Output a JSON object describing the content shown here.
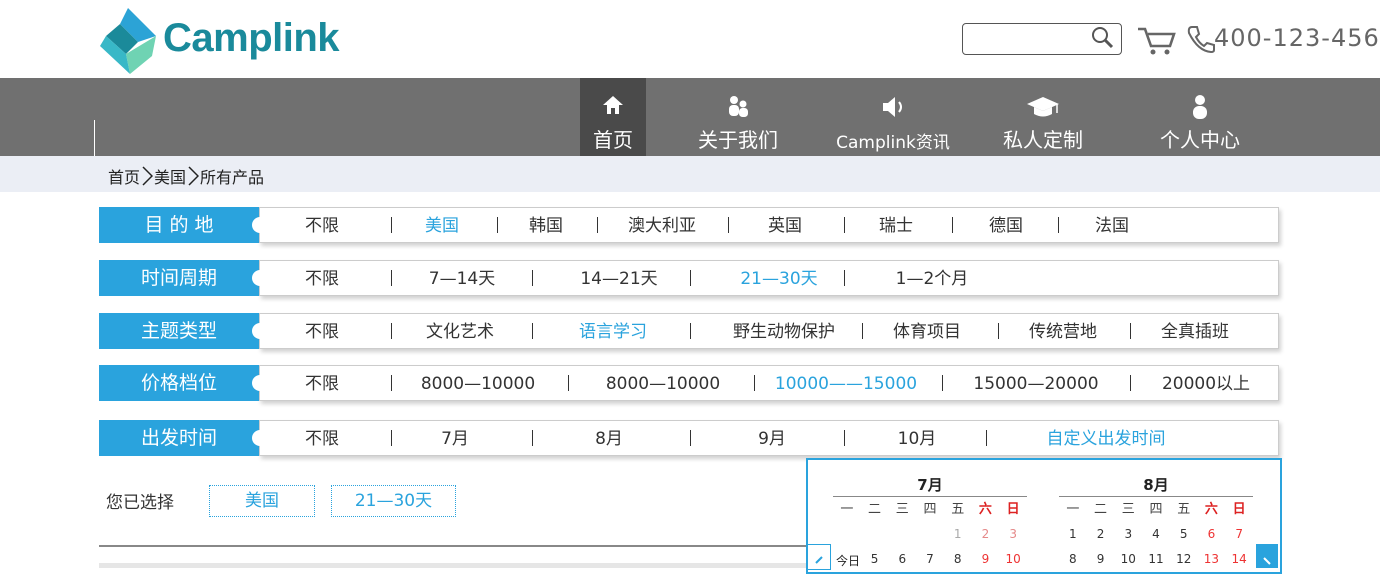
{
  "header": {
    "logo_text": "Camplink",
    "search": {
      "value": "",
      "placeholder": ""
    },
    "phone": "400-123-456"
  },
  "nav": {
    "items": [
      {
        "label": "首页",
        "icon": "home-icon",
        "active": true
      },
      {
        "label": "关于我们",
        "icon": "users-icon"
      },
      {
        "label": "Camplink资讯",
        "icon": "speaker-icon"
      },
      {
        "label": "私人定制",
        "icon": "graduation-cap-icon"
      },
      {
        "label": "个人中心",
        "icon": "user-icon"
      }
    ]
  },
  "breadcrumb": [
    "首页",
    "美国",
    "所有产品"
  ],
  "filters": [
    {
      "label": "目 的 地",
      "options": [
        "不限",
        "美国",
        "韩国",
        "澳大利亚",
        "英国",
        "瑞士",
        "德国",
        "法国"
      ],
      "selected": 1
    },
    {
      "label": "时间周期",
      "options": [
        "不限",
        "7—14天",
        "14—21天",
        "21—30天",
        "1—2个月"
      ],
      "selected": 3
    },
    {
      "label": "主题类型",
      "options": [
        "不限",
        "文化艺术",
        "语言学习",
        "野生动物保护",
        "体育项目",
        "传统营地",
        "全真插班"
      ],
      "selected": 2
    },
    {
      "label": "价格档位",
      "options": [
        "不限",
        "8000—10000",
        "8000—10000",
        "10000——15000",
        "15000—20000",
        "20000以上"
      ],
      "selected": 3
    },
    {
      "label": "出发时间",
      "options": [
        "不限",
        "7月",
        "8月",
        "9月",
        "10月",
        "自定义出发时间"
      ],
      "selected": 5
    }
  ],
  "selected_section": {
    "label": "您已选择",
    "chips": [
      "美国",
      "21—30天"
    ]
  },
  "calendar": {
    "today_label": "今日",
    "weekdays": [
      "一",
      "二",
      "三",
      "四",
      "五",
      "六",
      "日"
    ],
    "months": [
      {
        "title": "7月",
        "row1": [
          "",
          "",
          "",
          "",
          "1",
          "2",
          "3"
        ],
        "row2": [
          "5",
          "6",
          "7",
          "8",
          "9",
          "10"
        ]
      },
      {
        "title": "8月",
        "row1": [
          "1",
          "2",
          "3",
          "4",
          "5",
          "6",
          "7"
        ],
        "row2": [
          "8",
          "9",
          "10",
          "11",
          "12",
          "13",
          "14"
        ]
      }
    ]
  },
  "colors": {
    "accent": "#2aa3dd",
    "nav_bg": "#707070",
    "nav_active": "#4a4a4a",
    "weekend_red": "#d22222"
  }
}
